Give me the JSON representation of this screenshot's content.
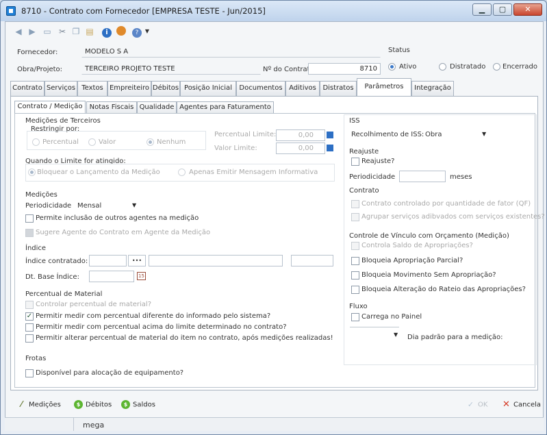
{
  "window": {
    "title": "8710 - Contrato com Fornecedor [EMPRESA TESTE - Jun/2015]",
    "minimize": "▁",
    "maximize": "▢",
    "close": "✕"
  },
  "toolbar": {
    "icons": [
      "back-icon",
      "forward-icon",
      "new-icon",
      "cut-icon",
      "copy-icon",
      "paste-icon",
      "info-icon",
      "user-icon",
      "help-icon",
      "dropdown-arrow-icon"
    ]
  },
  "header": {
    "fornecedor_label": "Fornecedor:",
    "fornecedor_value": "MODELO S A",
    "obra_label": "Obra/Projeto:",
    "obra_value": "TERCEIRO PROJETO TESTE",
    "contrato_label": "Nº do Contrato:",
    "contrato_value": "8710",
    "status_label": "Status",
    "status_options": [
      "Ativo",
      "Distratado",
      "Encerrado"
    ]
  },
  "tabs": [
    "Contrato",
    "Serviços",
    "Textos",
    "Empreiteiro",
    "Débitos",
    "Posição Inicial",
    "Documentos",
    "Aditivos",
    "Distratos",
    "Parâmetros",
    "Integração"
  ],
  "subtabs": [
    "Contrato / Medição",
    "Notas Fiscais",
    "Qualidade",
    "Agentes para Faturamento"
  ],
  "terceiros": {
    "title": "Medições de Terceiros",
    "restringir": "Restringir por:",
    "options": [
      "Percentual",
      "Valor",
      "Nenhum"
    ],
    "percentual_limite_label": "Percentual Limite:",
    "percentual_limite_value": "0,00",
    "valor_limite_label": "Valor Limite:",
    "valor_limite_value": "0,00",
    "quando_label": "Quando o Limite for atingido:",
    "bloquear": "Bloquear o Lançamento da Medição",
    "apenas": "Apenas Emitir Mensagem Informativa"
  },
  "medicoes": {
    "title": "Medições",
    "periodicidade_label": "Periodicidade",
    "periodicidade_value": "Mensal",
    "permite": "Permite inclusão de outros agentes na medição",
    "sugere": "Sugere Agente do Contrato em Agente da Medição"
  },
  "indice": {
    "title": "Índice",
    "contratado_label": "Índice contratado:",
    "ellipsis": "•••",
    "dt_base_label": "Dt. Base Índice:",
    "calendar": "15"
  },
  "material": {
    "title": "Percentual de Material",
    "items": [
      "Controlar percentual de material?",
      "Permitir medir com percentual diferente do informado pelo sistema?",
      "Permitir medir com percentual acima do limite determinado no contrato?",
      "Permitir alterar percentual de material do item no contrato, após medições realizadas!"
    ]
  },
  "frotas": {
    "title": "Frotas",
    "disponivel": "Disponível para alocação de equipamento?"
  },
  "iss": {
    "title": "ISS",
    "recolhimento_label": "Recolhimento de ISS:",
    "recolhimento_value": "Obra"
  },
  "reajuste": {
    "title": "Reajuste",
    "check": "Reajuste?",
    "periodicidade_label": "Periodicidade",
    "meses": "meses"
  },
  "contrato": {
    "title": "Contrato",
    "items": [
      "Contrato controlado por quantidade de fator (QF)",
      "Agrupar serviços adibvados com serviços existentes?"
    ]
  },
  "vinculo": {
    "title": "Controle de Vínculo com Orçamento  (Medição)",
    "items": [
      "Controla Saldo de Apropriações?",
      "Bloqueia Apropriação Parcial?",
      "Bloqueia Movimento Sem Apropriação?",
      "Bloqueia Alteração do Rateio das Apropriações?"
    ]
  },
  "fluxo": {
    "title": "Fluxo",
    "carrega": "Carrega no Painel",
    "dia_padrao": "Dia padrão para a medição:"
  },
  "bottom": {
    "medicoes": "Medições",
    "debitos": "Débitos",
    "saldos": "Saldos",
    "ok": "OK",
    "cancela": "Cancela"
  },
  "statusbar": {
    "user": "mega"
  },
  "colors": {
    "accent": "#3a78c8",
    "green": "#5cb531",
    "close_red": "#d63b26"
  }
}
